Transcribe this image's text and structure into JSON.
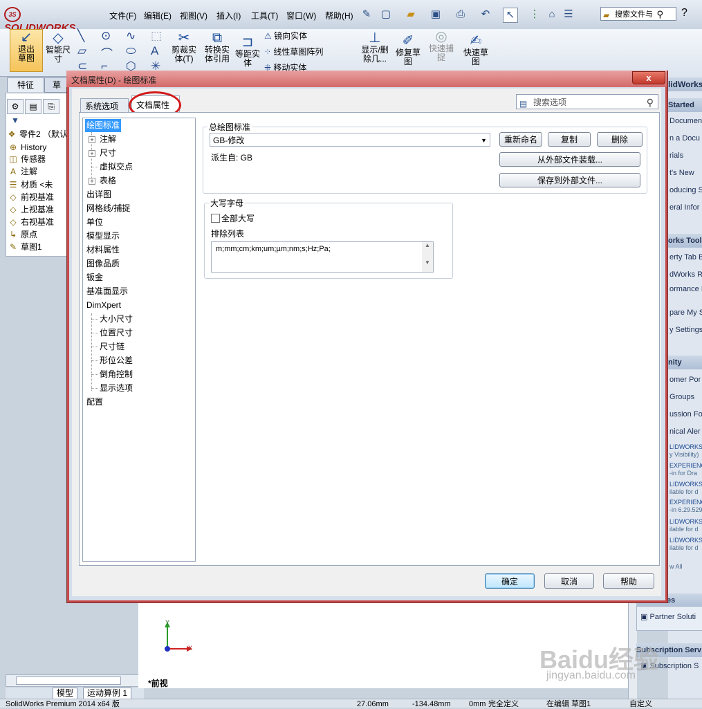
{
  "app": {
    "logo_text": "SOLIDWORKS",
    "menus": [
      "文件(F)",
      "编辑(E)",
      "视图(V)",
      "插入(I)",
      "工具(T)",
      "窗口(W)",
      "帮助(H)"
    ],
    "search_placeholder": "搜索文件与",
    "help_glyph": "?"
  },
  "ribbon": {
    "exit_sketch": "退出草图",
    "smart_dim": "智能尺寸",
    "trim": "剪裁实体(T)",
    "convert": "转换实体引用",
    "offset": "等距实体",
    "mirror": "镜向实体",
    "linear_pattern": "线性草图阵列",
    "move": "移动实体",
    "show_delete": "显示/删除几...",
    "repair": "修复草图",
    "quick_snap": "快速捕捉",
    "quick_sketch": "快速草图"
  },
  "feature_tabs": {
    "feature": "特征",
    "sketch": "草"
  },
  "tree": {
    "root": "零件2 （默认",
    "items": [
      "History",
      "传感器",
      "注解",
      "材质 <未",
      "前视基准",
      "上视基准",
      "右视基准",
      "原点",
      "草图1"
    ]
  },
  "bottom_tabs": {
    "model": "模型",
    "motion": "运动算例 1"
  },
  "status": {
    "product": "SolidWorks Premium 2014 x64 版",
    "x": "27.06mm",
    "y": "-134.48mm",
    "z": "0mm",
    "state": "完全定义",
    "editing": "在编辑 草图1",
    "custom": "自定义"
  },
  "view_label": "*前视",
  "axis": {
    "x": "X",
    "y": "Y"
  },
  "taskpane": {
    "brand_head": "lidWorks",
    "started_head": "Started",
    "started_items": [
      "Documen",
      "n a Docu",
      "rials",
      "t's New",
      "oducing S",
      "eral Infor"
    ],
    "tools_head": "orks Tools",
    "tools_items": [
      "erty Tab B",
      "dWorks R",
      "ormance B",
      "pare My S",
      "y Settings"
    ],
    "community_head": "nity",
    "community_items": [
      "omer Por",
      "Groups",
      "ussion For",
      "nical Aler"
    ],
    "news_items": [
      {
        "title": "LIDWORKS",
        "sub": "y Visibility)"
      },
      {
        "title": "EXPERIENC",
        "sub": "-in for Dra"
      },
      {
        "title": "LIDWORKS",
        "sub": "ilable for d"
      },
      {
        "title": "EXPERIENC",
        "sub": "-in 6.29.529"
      },
      {
        "title": "LIDWORKS",
        "sub": "ilable for d"
      },
      {
        "title": "LIDWORKS",
        "sub": "ilable for d"
      }
    ],
    "view_all": "w All",
    "resources_head": "Resources",
    "partner": "Partner Soluti",
    "subscription_head": "Subscription Serv",
    "subscription": "Subscription S"
  },
  "dialog": {
    "title": "文档属性(D) - 绘图标准",
    "close": "x",
    "tab_system": "系统选项(S)",
    "tab_document": "文档属性(D)",
    "search_placeholder": "搜索选项",
    "nav": {
      "selected": "绘图标准",
      "annotation": "注解",
      "dimension": "尺寸",
      "virtual": "虚拟交点",
      "table": "表格",
      "detailing": "出详图",
      "grid": "网格线/捕捉",
      "units": "单位",
      "model_display": "模型显示",
      "material": "材料属性",
      "image_quality": "图像品质",
      "sheet_metal": "钣金",
      "plane_display": "基准面显示",
      "dimxpert": "DimXpert",
      "dx_items": [
        "大小尺寸",
        "位置尺寸",
        "尺寸链",
        "形位公差",
        "倒角控制",
        "显示选项"
      ],
      "config": "配置"
    },
    "overall_standard": {
      "label": "总绘图标准",
      "value": "GB-修改",
      "derived": "派生自: GB",
      "rename": "重新命名",
      "copy": "复制",
      "delete": "删除",
      "load_external": "从外部文件装载...",
      "save_external": "保存到外部文件..."
    },
    "uppercase": {
      "label": "大写字母",
      "all_caps": "全部大写",
      "all_caps_checked": false,
      "exclude_label": "排除列表",
      "exclude_value": "m;mm;cm;km;um;µm;nm;s;Hz;Pa;"
    },
    "ok": "确定",
    "cancel": "取消",
    "help": "帮助"
  },
  "watermark": {
    "main": "Baidu经验",
    "sub": "jingyan.baidu.com"
  }
}
